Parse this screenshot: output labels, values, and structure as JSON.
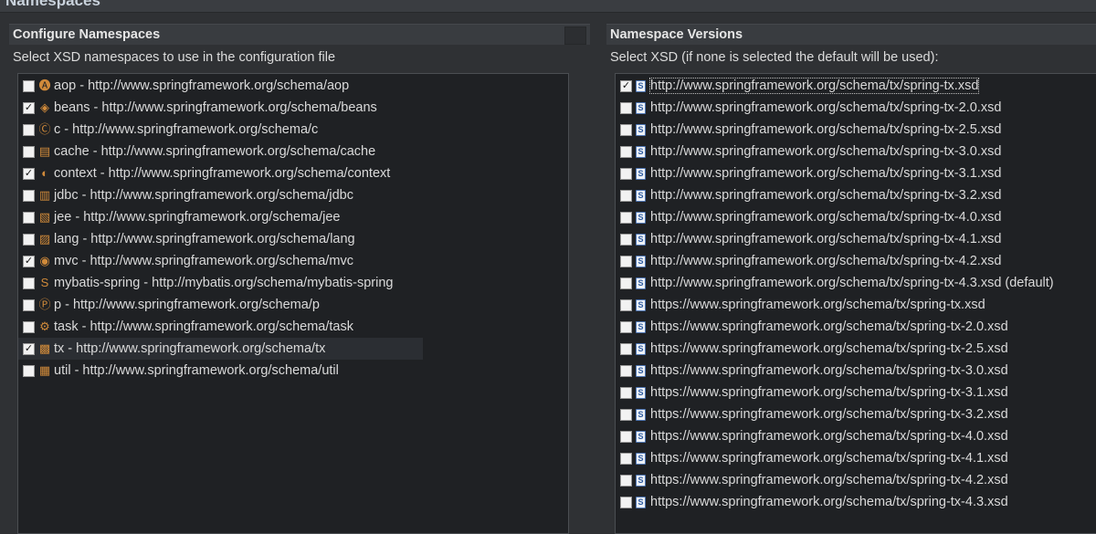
{
  "window": {
    "title": "Namespaces"
  },
  "left": {
    "header": "Configure Namespaces",
    "description": "Select XSD namespaces to use in the configuration file",
    "items": [
      {
        "label": "aop - http://www.springframework.org/schema/aop",
        "checked": false,
        "icon": "aop-namespace-icon",
        "glyph": "🅐"
      },
      {
        "label": "beans - http://www.springframework.org/schema/beans",
        "checked": true,
        "icon": "beans-namespace-icon",
        "glyph": "◈"
      },
      {
        "label": "c - http://www.springframework.org/schema/c",
        "checked": false,
        "icon": "c-namespace-icon",
        "glyph": "Ⓒ"
      },
      {
        "label": "cache - http://www.springframework.org/schema/cache",
        "checked": false,
        "icon": "cache-namespace-icon",
        "glyph": "▤"
      },
      {
        "label": "context - http://www.springframework.org/schema/context",
        "checked": true,
        "icon": "context-namespace-icon",
        "glyph": "◐"
      },
      {
        "label": "jdbc - http://www.springframework.org/schema/jdbc",
        "checked": false,
        "icon": "jdbc-namespace-icon",
        "glyph": "▥"
      },
      {
        "label": "jee - http://www.springframework.org/schema/jee",
        "checked": false,
        "icon": "jee-namespace-icon",
        "glyph": "▧"
      },
      {
        "label": "lang - http://www.springframework.org/schema/lang",
        "checked": false,
        "icon": "lang-namespace-icon",
        "glyph": "▨"
      },
      {
        "label": "mvc - http://www.springframework.org/schema/mvc",
        "checked": true,
        "icon": "mvc-namespace-icon",
        "glyph": "◉"
      },
      {
        "label": "mybatis-spring - http://mybatis.org/schema/mybatis-spring",
        "checked": false,
        "icon": "mybatis-spring-namespace-icon",
        "glyph": "S"
      },
      {
        "label": "p - http://www.springframework.org/schema/p",
        "checked": false,
        "icon": "p-namespace-icon",
        "glyph": "Ⓟ"
      },
      {
        "label": "task - http://www.springframework.org/schema/task",
        "checked": false,
        "icon": "task-namespace-icon",
        "glyph": "⚙"
      },
      {
        "label": "tx - http://www.springframework.org/schema/tx",
        "checked": true,
        "icon": "tx-namespace-icon",
        "glyph": "▩",
        "selected": true
      },
      {
        "label": "util - http://www.springframework.org/schema/util",
        "checked": false,
        "icon": "util-namespace-icon",
        "glyph": "▦"
      }
    ]
  },
  "right": {
    "header": "Namespace Versions",
    "description": "Select XSD (if none is selected the default will be used):",
    "items": [
      {
        "label": "http://www.springframework.org/schema/tx/spring-tx.xsd",
        "checked": true,
        "focused": true
      },
      {
        "label": "http://www.springframework.org/schema/tx/spring-tx-2.0.xsd",
        "checked": false
      },
      {
        "label": "http://www.springframework.org/schema/tx/spring-tx-2.5.xsd",
        "checked": false
      },
      {
        "label": "http://www.springframework.org/schema/tx/spring-tx-3.0.xsd",
        "checked": false
      },
      {
        "label": "http://www.springframework.org/schema/tx/spring-tx-3.1.xsd",
        "checked": false
      },
      {
        "label": "http://www.springframework.org/schema/tx/spring-tx-3.2.xsd",
        "checked": false
      },
      {
        "label": "http://www.springframework.org/schema/tx/spring-tx-4.0.xsd",
        "checked": false
      },
      {
        "label": "http://www.springframework.org/schema/tx/spring-tx-4.1.xsd",
        "checked": false
      },
      {
        "label": "http://www.springframework.org/schema/tx/spring-tx-4.2.xsd",
        "checked": false
      },
      {
        "label": "http://www.springframework.org/schema/tx/spring-tx-4.3.xsd (default)",
        "checked": false
      },
      {
        "label": "https://www.springframework.org/schema/tx/spring-tx.xsd",
        "checked": false
      },
      {
        "label": "https://www.springframework.org/schema/tx/spring-tx-2.0.xsd",
        "checked": false
      },
      {
        "label": "https://www.springframework.org/schema/tx/spring-tx-2.5.xsd",
        "checked": false
      },
      {
        "label": "https://www.springframework.org/schema/tx/spring-tx-3.0.xsd",
        "checked": false
      },
      {
        "label": "https://www.springframework.org/schema/tx/spring-tx-3.1.xsd",
        "checked": false
      },
      {
        "label": "https://www.springframework.org/schema/tx/spring-tx-3.2.xsd",
        "checked": false
      },
      {
        "label": "https://www.springframework.org/schema/tx/spring-tx-4.0.xsd",
        "checked": false
      },
      {
        "label": "https://www.springframework.org/schema/tx/spring-tx-4.1.xsd",
        "checked": false
      },
      {
        "label": "https://www.springframework.org/schema/tx/spring-tx-4.2.xsd",
        "checked": false
      },
      {
        "label": "https://www.springframework.org/schema/tx/spring-tx-4.3.xsd",
        "checked": false
      }
    ],
    "xsd_icon_glyph": "S"
  },
  "colors": {
    "background": "#2f3134",
    "list_background": "#1f2124",
    "selected_row": "#2b2e33",
    "xsd_icon_border": "#4f76b3"
  }
}
